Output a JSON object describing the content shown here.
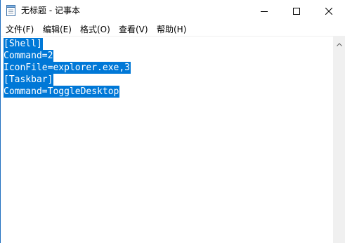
{
  "window": {
    "title": "无标题 - 记事本"
  },
  "menu": {
    "file": "文件(F)",
    "edit": "编辑(E)",
    "format": "格式(O)",
    "view": "查看(V)",
    "help": "帮助(H)"
  },
  "editor": {
    "lines": [
      "[Shell]",
      "Command=2",
      "IconFile=explorer.exe,3",
      "[Taskbar]",
      "Command=ToggleDesktop"
    ],
    "selection_color": "#0078d7"
  },
  "icons": {
    "app": "notepad-icon",
    "minimize": "minimize-icon",
    "maximize": "maximize-icon",
    "close": "close-icon",
    "scroll_up": "chevron-up-icon"
  }
}
